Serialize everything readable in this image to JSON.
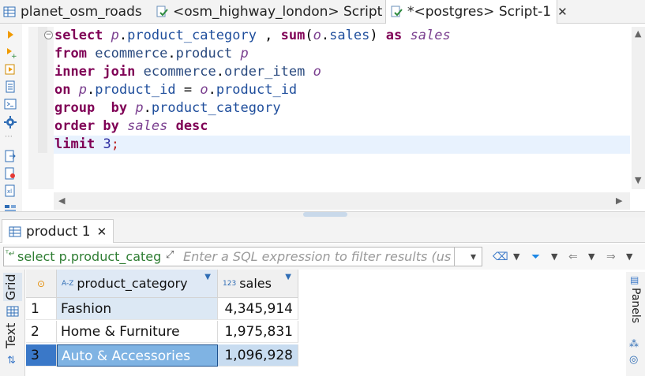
{
  "tabs": [
    {
      "label": "planet_osm_roads",
      "icon": "table-icon",
      "active": false
    },
    {
      "label": "<osm_highway_london> Script",
      "icon": "sql-script-icon",
      "active": false
    },
    {
      "label": "*<postgres> Script-1",
      "icon": "sql-script-icon",
      "active": true,
      "close": "✕"
    }
  ],
  "editor": {
    "lines": [
      "select p.product_category , sum(o.sales) as sales",
      "from ecommerce.product p",
      "inner join ecommerce.order_item o",
      "on p.product_id = o.product_id",
      "group  by p.product_category",
      "order by sales desc",
      "limit 3;"
    ]
  },
  "results": {
    "tab_label": "product 1",
    "tab_close": "✕",
    "filter_query": "select p.product_categ",
    "filter_placeholder": "Enter a SQL expression to filter results (use Ctrl+Space)",
    "side_tabs": {
      "grid": "Grid",
      "text": "Text"
    },
    "panels_label": "Panels",
    "columns": [
      {
        "label": "product_category",
        "type_badge": "A-Z"
      },
      {
        "label": "sales",
        "type_badge": "123"
      }
    ],
    "rows": [
      {
        "num": "1",
        "product_category": "Fashion",
        "sales": "4,345,914"
      },
      {
        "num": "2",
        "product_category": "Home & Furniture",
        "sales": "1,975,831"
      },
      {
        "num": "3",
        "product_category": "Auto & Accessories",
        "sales": "1,096,928"
      }
    ]
  },
  "colors": {
    "keyword": "#7f0055",
    "selection": "#7fb3e3",
    "filter_query": "#2e7d32"
  }
}
